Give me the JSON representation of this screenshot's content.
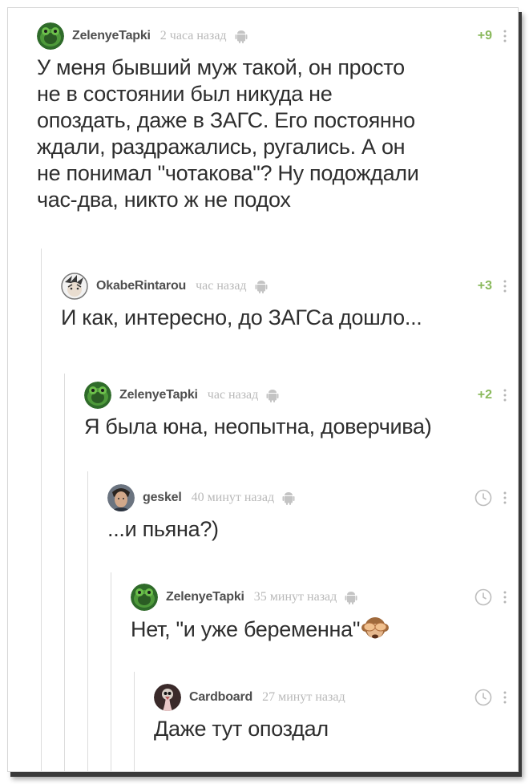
{
  "comments": [
    {
      "author": "ZelenyeTapki",
      "time": "2 часа назад",
      "rating": "+9",
      "avatar_icon": "green-turtle-avatar",
      "text_lines": [
        "У меня бывший муж такой, он просто",
        "не в состоянии был никуда не",
        "опоздать, даже в ЗАГС. Его постоянно",
        "ждали, раздражались, ругались. А он",
        "не понимал \"чотакова\"? Ну подождали",
        "час-два, никто ж не подох"
      ]
    },
    {
      "author": "OkabeRintarou",
      "time": "час назад",
      "rating": "+3",
      "avatar_icon": "anime-face-avatar",
      "text_lines": [
        "И как, интересно, до ЗАГСа дошло..."
      ]
    },
    {
      "author": "ZelenyeTapki",
      "time": "час назад",
      "rating": "+2",
      "avatar_icon": "green-turtle-avatar",
      "text_lines": [
        "Я была юна, неопытна, доверчива)"
      ]
    },
    {
      "author": "geskel",
      "time": "40 минут назад",
      "rating": "",
      "avatar_icon": "person-photo-avatar",
      "text_lines": [
        "...и пьяна?)"
      ]
    },
    {
      "author": "ZelenyeTapki",
      "time": "35 минут назад",
      "rating": "",
      "avatar_icon": "green-turtle-avatar",
      "text_lines": [
        "Нет, \"и уже беременна\""
      ],
      "emoji": "see-no-evil-monkey-icon"
    },
    {
      "author": "Cardboard",
      "time": "27 минут назад",
      "rating": "",
      "avatar_icon": "ostrich-avatar",
      "text_lines": [
        "Даже тут опоздал"
      ]
    }
  ],
  "icons": {
    "platform": "android-icon",
    "pending_rating": "clock-icon",
    "menu": "more-vertical-icon"
  },
  "colors": {
    "rating_positive": "#8ab95c",
    "time": "#b9b9b9",
    "author": "#4f4f4f",
    "text": "#2e2e2e",
    "thread_line": "#dcdcdc"
  }
}
